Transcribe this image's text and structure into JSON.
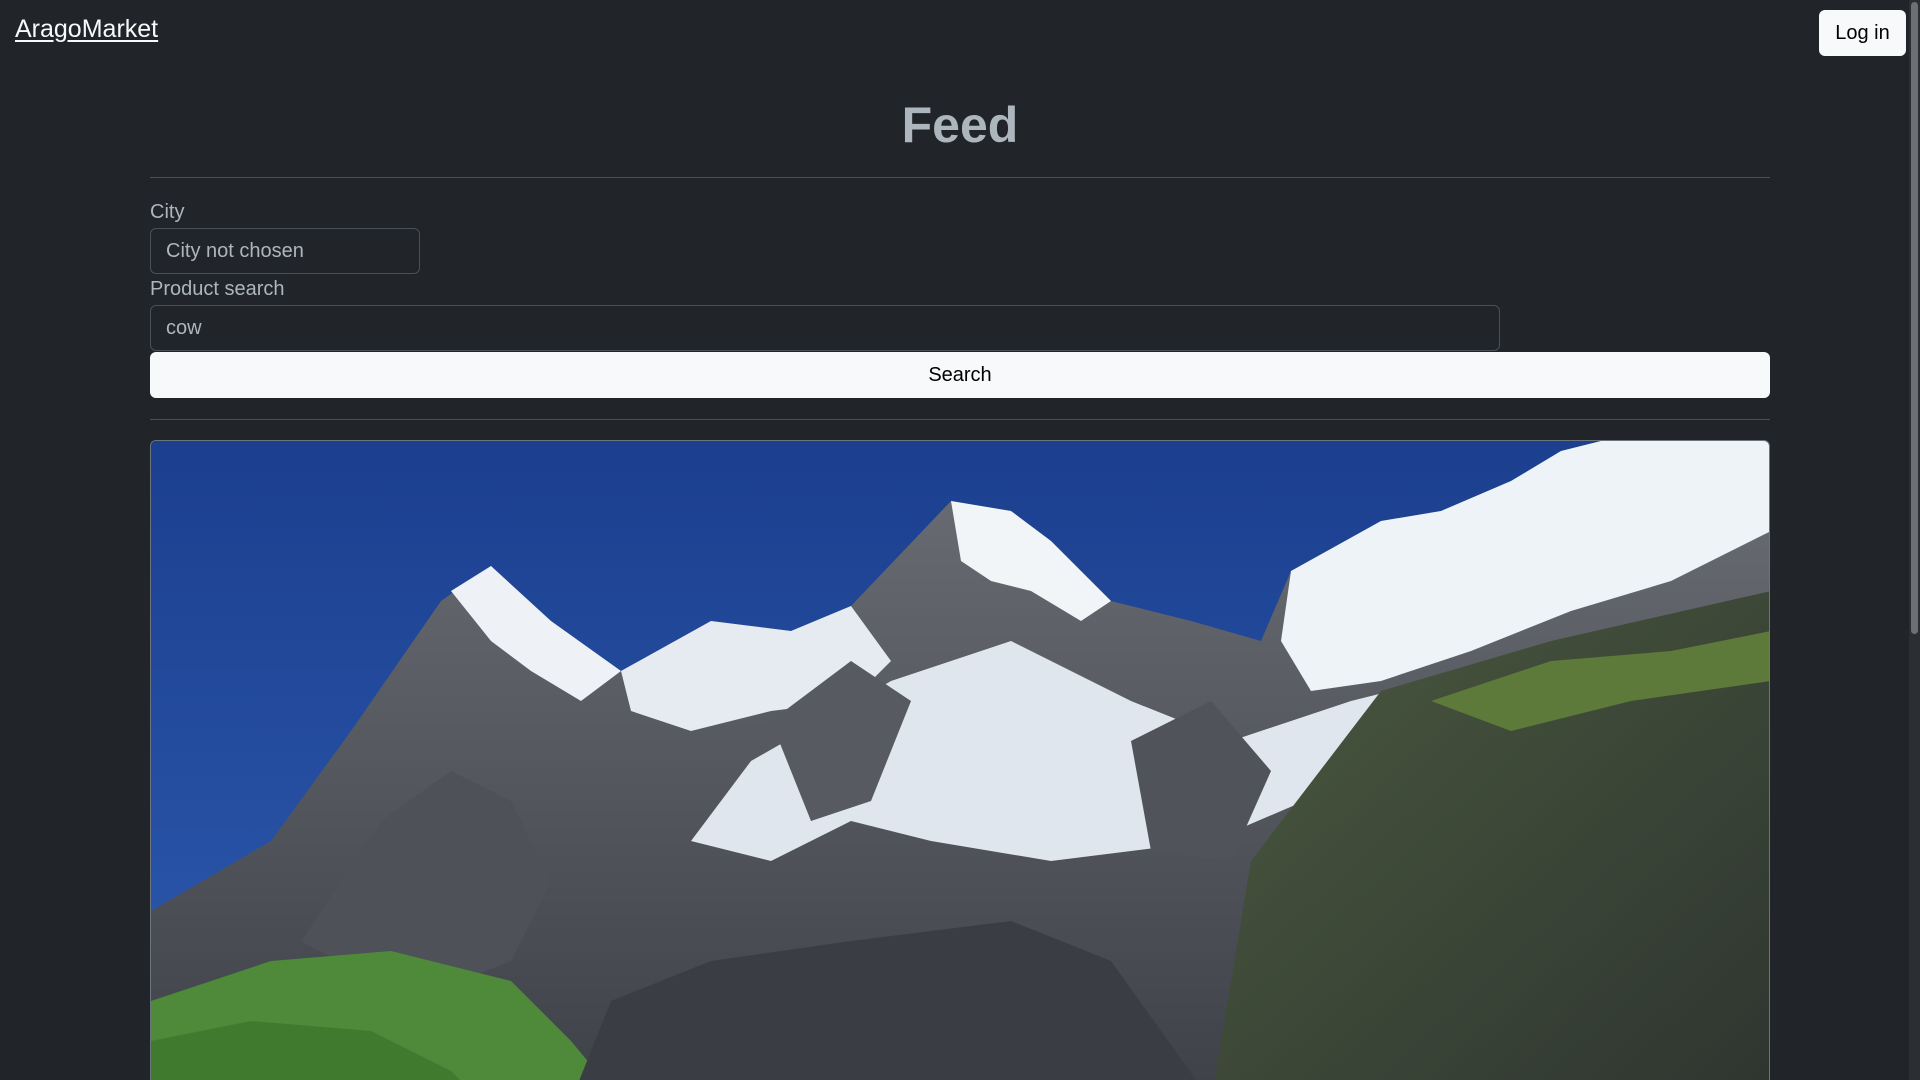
{
  "navbar": {
    "brand": "AragoMarket",
    "login_label": "Log in"
  },
  "page": {
    "title": "Feed"
  },
  "filters": {
    "city_label": "City",
    "city_value": "City not chosen",
    "product_label": "Product search",
    "product_value": "cow",
    "search_label": "Search"
  },
  "feed": {
    "items": [
      {
        "image": "mountain-landscape"
      }
    ]
  },
  "colors": {
    "background": "#212529",
    "button": "#f8f9fa",
    "muted_text": "#adb5bd",
    "border": "#495057"
  }
}
